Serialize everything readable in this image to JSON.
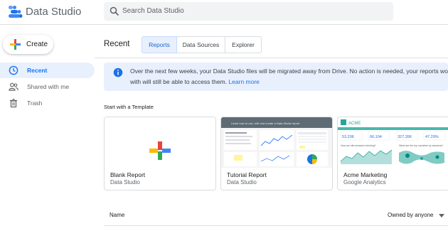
{
  "header": {
    "app_title": "Data Studio",
    "search_placeholder": "Search Data Studio",
    "logo_icon": "data-studio-logo",
    "colors": {
      "logo_blue": "#4285f4",
      "logo_dark": "#1a73e8"
    }
  },
  "sidebar": {
    "create_label": "Create",
    "items": [
      {
        "label": "Recent",
        "icon": "clock-icon",
        "active": true
      },
      {
        "label": "Shared with me",
        "icon": "people-icon",
        "active": false
      },
      {
        "label": "Trash",
        "icon": "trash-icon",
        "active": false
      }
    ]
  },
  "main": {
    "title": "Recent",
    "tabs": [
      {
        "label": "Reports",
        "active": true
      },
      {
        "label": "Data Sources",
        "active": false
      },
      {
        "label": "Explorer",
        "active": false
      }
    ],
    "banner": {
      "line1": "Over the next few weeks, your Data Studio files will be migrated away from Drive. No action is needed, your reports won't change",
      "line2": "with will still be able to access them.",
      "link": "Learn more"
    },
    "templates_title": "Start with a Template",
    "templates": [
      {
        "title": "Blank Report",
        "subtitle": "Data Studio"
      },
      {
        "title": "Tutorial Report",
        "subtitle": "Data Studio"
      },
      {
        "title": "Acme Marketing",
        "subtitle": "Google Analytics"
      }
    ],
    "list": {
      "col_name": "Name",
      "col_owner": "Owned by anyone"
    },
    "thumbs": {
      "tutorial_header": "Learn how to use, edit and create a Data Studio report",
      "acme_brand": "ACME",
      "acme_stats": [
        "53,206",
        "66,104",
        "327,396",
        "47.29%"
      ],
      "acme_q1": "How are site sessions trending?",
      "acme_q2": "What are the top countries by sessions?"
    }
  }
}
